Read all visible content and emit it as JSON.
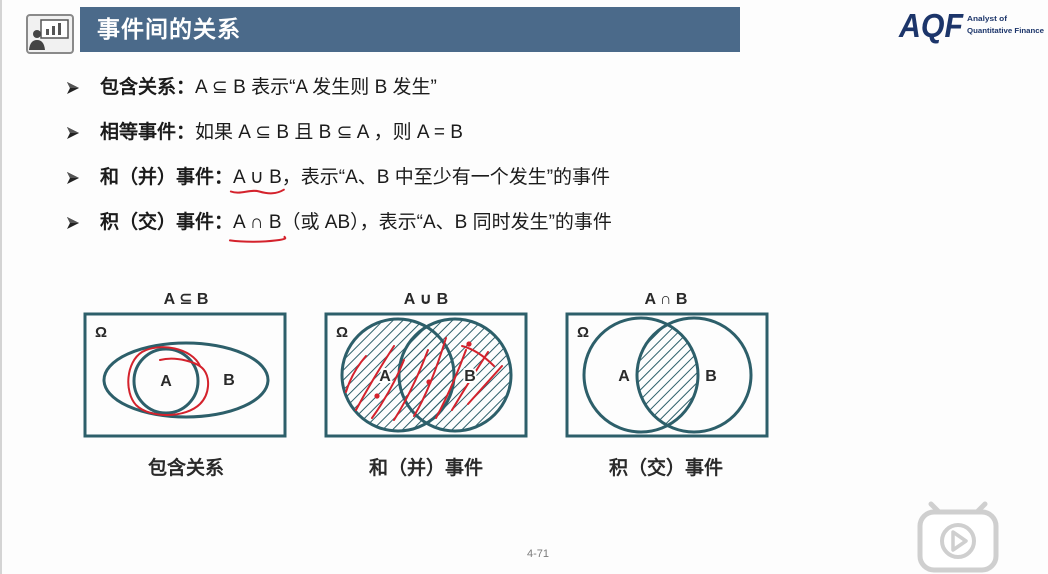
{
  "slide": {
    "title": "事件间的关系",
    "page_number": "4-71"
  },
  "logo": {
    "mark": "AQF",
    "tagline_line1": "Analyst of",
    "tagline_line2": "Quantitative Finance"
  },
  "bullets": [
    {
      "term": "包含关系：",
      "text": "A ⊆ B 表示“A 发生则 B 发生”"
    },
    {
      "term": "相等事件：",
      "text": "如果 A ⊆ B 且 B ⊆ A ，则 A = B"
    },
    {
      "term": "和（并）事件：",
      "highlight": "A ∪ B",
      "text": "，表示“A、B 中至少有一个发生”的事件"
    },
    {
      "term": "积（交）事件：",
      "highlight": "A ∩ B",
      "text": "（或 AB），表示“A、B 同时发生”的事件"
    }
  ],
  "diagrams": [
    {
      "label": "A ⊆ B",
      "universe": "Ω",
      "set_a": "A",
      "set_b": "B",
      "caption": "包含关系"
    },
    {
      "label": "A ∪ B",
      "universe": "Ω",
      "set_a": "A",
      "set_b": "B",
      "caption": "和（并）事件"
    },
    {
      "label": "A ∩ B",
      "universe": "Ω",
      "set_a": "A",
      "set_b": "B",
      "caption": "积（交）事件"
    }
  ],
  "icons": {
    "header": "presenter-icon",
    "bullet": "arrow-bullet-icon",
    "player": "play-icon"
  },
  "colors": {
    "title_bar": "#4b6a8a",
    "title_text": "#ffffff",
    "diagram_stroke": "#2d5f6a",
    "annotation": "#d4222c",
    "logo": "#1c356a"
  }
}
